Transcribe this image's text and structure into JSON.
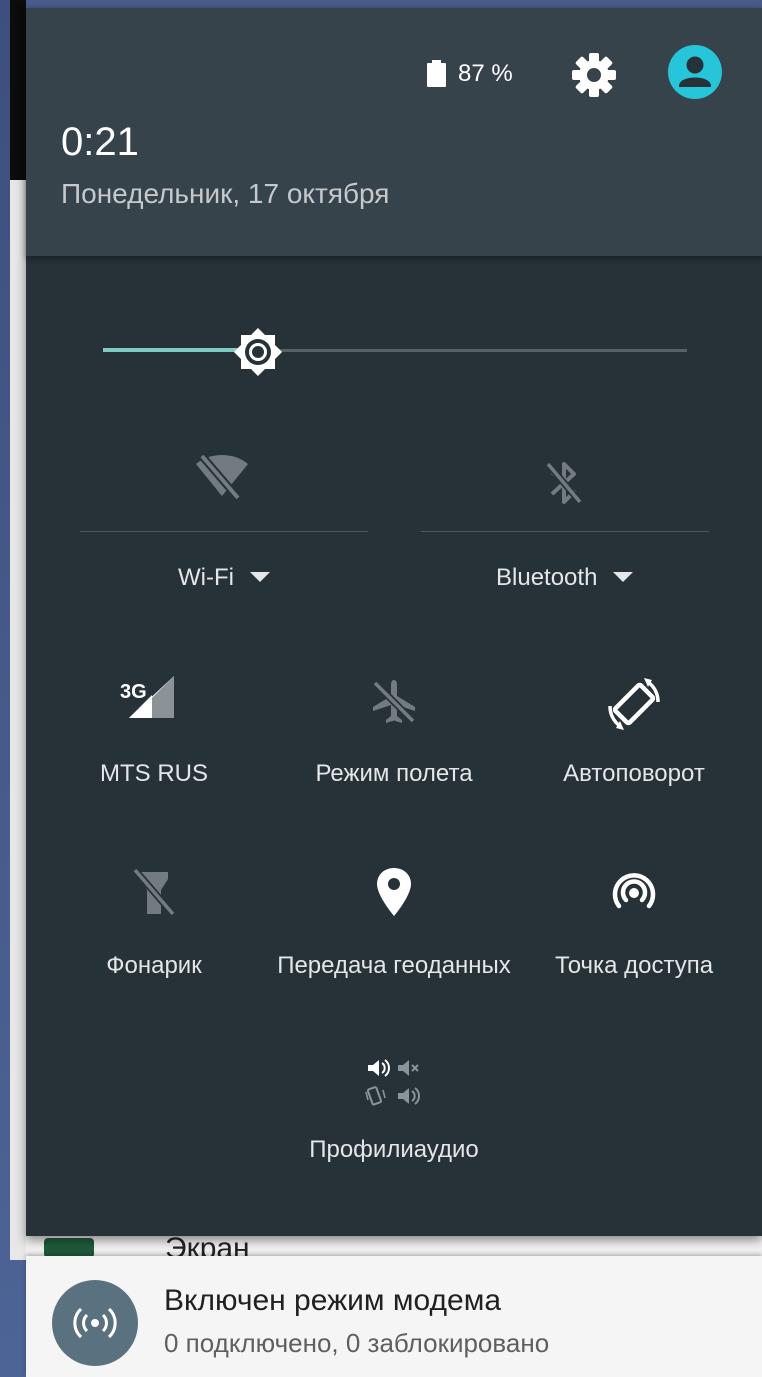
{
  "background": {
    "app_label": "Экран"
  },
  "status": {
    "battery_icon": "battery-icon",
    "battery_text": "87 %",
    "settings_icon": "gear-icon",
    "avatar_icon": "user-avatar-icon",
    "avatar_color": "#26c6da"
  },
  "header": {
    "time": "0:21",
    "date": "Понедельник, 17 октября"
  },
  "brightness": {
    "level": 0.265,
    "accent_color": "#80cbc4"
  },
  "detail_tiles": [
    {
      "label": "Wi-Fi",
      "icon": "wifi-off-icon",
      "state": "off"
    },
    {
      "label": "Bluetooth",
      "icon": "bluetooth-off-icon",
      "state": "off"
    }
  ],
  "tiles": [
    {
      "label": "MTS RUS",
      "icon": "cellular-3g-icon",
      "badge": "3G"
    },
    {
      "label": "Режим полета",
      "icon": "airplane-off-icon"
    },
    {
      "label": "Автоповорот",
      "icon": "auto-rotate-icon"
    },
    {
      "label": "Фонарик",
      "icon": "flashlight-off-icon"
    },
    {
      "label": "Передача геоданных",
      "icon": "location-pin-icon"
    },
    {
      "label": "Точка доступа",
      "icon": "hotspot-icon"
    }
  ],
  "audio_tile": {
    "label": "Профилиаудио",
    "icon": "audio-profiles-icon"
  },
  "notification": {
    "icon": "tethering-icon",
    "title": "Включен режим модема",
    "text": "0 подключено, 0 заблокировано"
  },
  "colors": {
    "shade_background": "#263238",
    "header_background": "#37434b",
    "notification_background": "#f5f5f5"
  }
}
